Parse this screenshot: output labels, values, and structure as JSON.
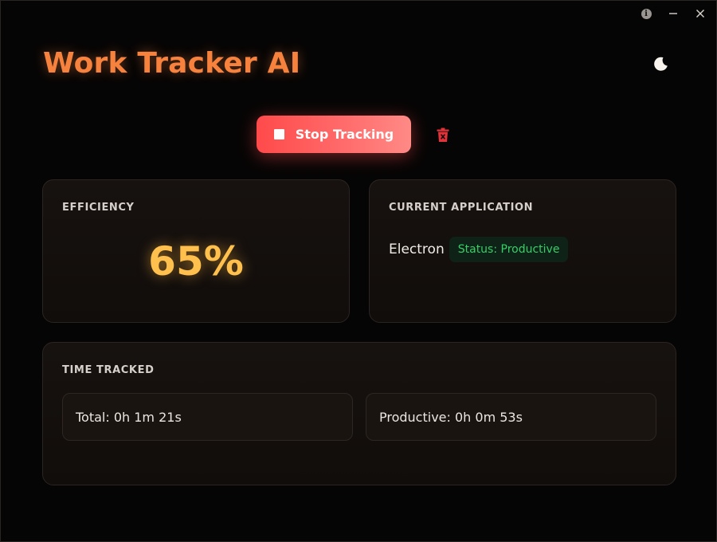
{
  "window": {
    "controls": [
      {
        "icon": "info-icon",
        "glyph": "i"
      },
      {
        "icon": "minimize-icon",
        "glyph": "—"
      },
      {
        "icon": "close-icon",
        "glyph": "✕"
      }
    ]
  },
  "header": {
    "title": "Work Tracker AI",
    "theme_icon": "moon-icon"
  },
  "actions": {
    "stop_label": "Stop Tracking",
    "stop_icon": "stop-icon",
    "delete_icon": "trash-icon"
  },
  "efficiency": {
    "title": "EFFICIENCY",
    "value": "65%"
  },
  "current_app": {
    "title": "CURRENT APPLICATION",
    "name": "Electron",
    "status": "Status: Productive"
  },
  "time_tracked": {
    "title": "TIME TRACKED",
    "total": "Total: 0h 1m 21s",
    "productive": "Productive: 0h 0m 53s"
  },
  "colors": {
    "accent": "#f6823e",
    "stop_button": "#ff5a5a",
    "efficiency": "#ffc04d",
    "productive_status": "#33d066",
    "trash": "#e0333a"
  }
}
